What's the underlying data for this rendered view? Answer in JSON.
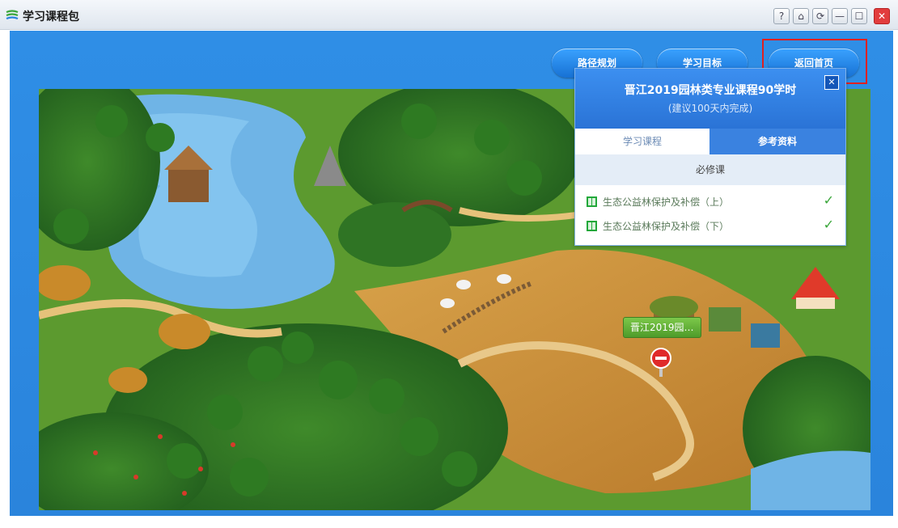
{
  "window": {
    "title": "学习课程包",
    "controls": [
      "?",
      "⌂",
      "⟳",
      "—",
      "☐",
      "✕"
    ]
  },
  "nav": {
    "buttons": [
      "路径规划",
      "学习目标",
      "返回首页"
    ],
    "highlighted": "返回首页"
  },
  "panel": {
    "title": "晋江2019园林类专业课程90学时",
    "subtitle": "(建议100天内完成)",
    "close": "✕",
    "tabs": [
      "学习课程",
      "参考资料"
    ],
    "active_tab": "学习课程",
    "section": "必修课",
    "courses": [
      {
        "label": "生态公益林保护及补偿（上）",
        "check": "✓"
      },
      {
        "label": "生态公益林保护及补偿（下）",
        "check": "✓"
      }
    ]
  },
  "map": {
    "marker_label": "晋江2019园…"
  },
  "colors": {
    "frame_blue": "#2f8ee6",
    "highlight_red": "#e02020",
    "check_green": "#3aa63a"
  }
}
